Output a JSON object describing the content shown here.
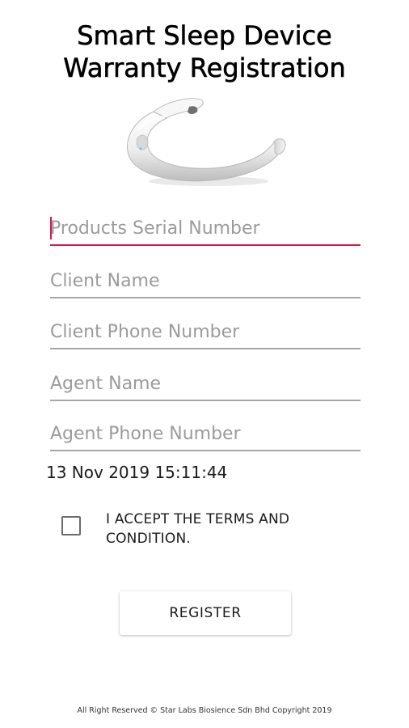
{
  "header": {
    "title_line1": "Smart Sleep Device",
    "title_line2": "Warranty Registration"
  },
  "product_image": {
    "icon": "sleep-headband-device-image"
  },
  "form": {
    "fields": [
      {
        "placeholder": "Products Serial Number",
        "value": "",
        "focused": true
      },
      {
        "placeholder": "Client Name",
        "value": ""
      },
      {
        "placeholder": "Client Phone Number",
        "value": ""
      },
      {
        "placeholder": "Agent Name",
        "value": ""
      },
      {
        "placeholder": "Agent Phone Number",
        "value": ""
      }
    ],
    "timestamp": "13 Nov 2019 15:11:44",
    "terms": {
      "label": "I ACCEPT THE TERMS AND CONDITION.",
      "checked": false
    },
    "register_label": "REGISTER"
  },
  "footer": {
    "copyright": "All Right Reserved © Star Labs Biosience Sdn Bhd Copyright 2019"
  },
  "colors": {
    "accent": "#d81b4a",
    "underline": "#a6a6a6",
    "placeholder": "#9b9b9b",
    "background": "#ffffff"
  }
}
